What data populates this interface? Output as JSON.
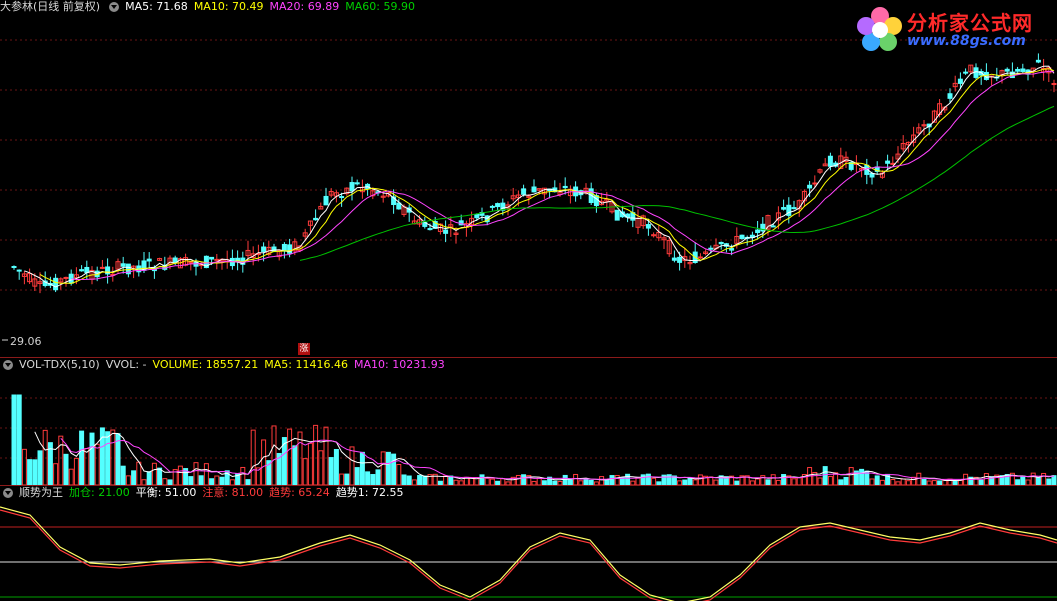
{
  "price_header": {
    "title": "大参林(日线 前复权)",
    "ma5": "MA5: 71.68",
    "ma10": "MA10: 70.49",
    "ma20": "MA20: 69.89",
    "ma60": "MA60: 59.90"
  },
  "price_low_label": "29.06",
  "zhang_badge": "涨",
  "vol_header": {
    "title": "VOL-TDX(5,10)",
    "vvol": "VVOL: -",
    "volume": "VOLUME: 18557.21",
    "ma5": "MA5: 11416.46",
    "ma10": "MA10: 10231.93"
  },
  "osc_header": {
    "title": "顺势为王",
    "jiacang": "加仓: 21.00",
    "pingheng": "平衡: 51.00",
    "zhuyi": "注意: 81.00",
    "qushi": "趋势: 65.24",
    "qushi1": "趋势1: 72.55"
  },
  "logo": {
    "name": "分析家公式网",
    "url": "www.88gs.com"
  },
  "colors": {
    "ma5": "#ffffff",
    "ma10": "#ffff00",
    "ma20": "#ff44ff",
    "ma60": "#00c000",
    "up": "#ff3b3b",
    "down": "#54ffff",
    "separator": "#8b1a1a"
  }
}
